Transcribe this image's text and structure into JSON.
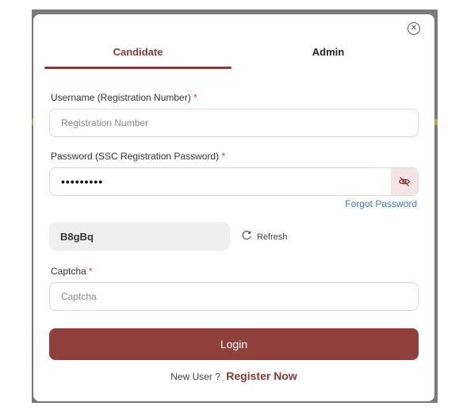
{
  "modal": {
    "tabs": [
      {
        "label": "Candidate",
        "active": true
      },
      {
        "label": "Admin",
        "active": false
      }
    ],
    "username": {
      "label": "Username (Registration Number)",
      "required_mark": "*",
      "placeholder": "Registration Number",
      "value": ""
    },
    "password": {
      "label": "Password (SSC Registration Password)",
      "required_mark": "*",
      "value": "•••••••••",
      "toggle_icon": "eye-off-icon"
    },
    "forgot_password": "Forgot Password",
    "captcha_image_text": "B8gBq",
    "refresh_label": "Refresh",
    "captcha": {
      "label": "Captcha",
      "required_mark": "*",
      "placeholder": "Captcha",
      "value": ""
    },
    "login_label": "Login",
    "register": {
      "prompt": "New User ?",
      "link": "Register Now"
    }
  },
  "colors": {
    "accent": "#8a3a36",
    "button": "#8f403a",
    "link": "#3a7ad9",
    "required": "#e0322d"
  }
}
